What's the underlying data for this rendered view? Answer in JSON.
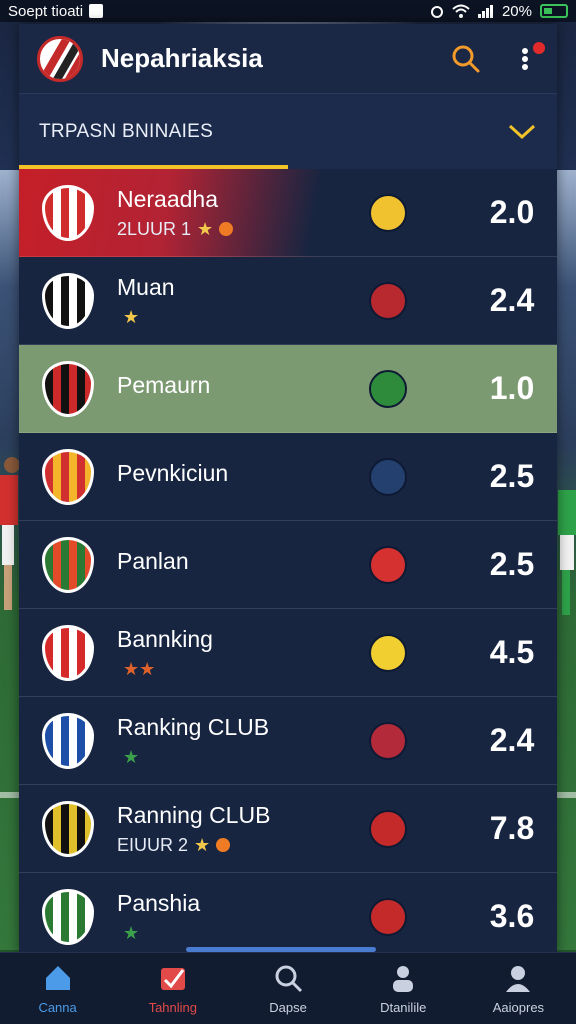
{
  "status_bar": {
    "left_text": "Soept tioati",
    "battery": "20%"
  },
  "header": {
    "title": "Nepahriaksia"
  },
  "filter": {
    "label": "TRPASN BNINAIES",
    "progress": 0.5
  },
  "rows": [
    {
      "name": "Neraadha",
      "sub": "2LUUR 1",
      "score": "2.0",
      "crest_colors": [
        "#d12c2c",
        "#ffffff"
      ],
      "opp_color": "#f1c230",
      "highlight": "first"
    },
    {
      "name": "Muan",
      "sub": "",
      "score": "2.4",
      "crest_colors": [
        "#111111",
        "#ffffff"
      ],
      "opp_color": "#b8282f"
    },
    {
      "name": "Pemaurn",
      "sub": "",
      "score": "1.0",
      "crest_colors": [
        "#111111",
        "#cc2a2a"
      ],
      "opp_color": "#2e8b3b",
      "highlight": "green"
    },
    {
      "name": "Pevnkiciun",
      "sub": "",
      "score": "2.5",
      "crest_colors": [
        "#d03030",
        "#f5b52a"
      ],
      "opp_color": "#24406f"
    },
    {
      "name": "Panlan",
      "sub": "",
      "score": "2.5",
      "crest_colors": [
        "#2a7a34",
        "#e24a2a"
      ],
      "opp_color": "#d63131"
    },
    {
      "name": "Bannking",
      "sub": "",
      "score": "4.5",
      "crest_colors": [
        "#d62a2a",
        "#ffffff"
      ],
      "opp_color": "#f2cf30"
    },
    {
      "name": "Ranking CLUB",
      "sub": "",
      "score": "2.4",
      "crest_colors": [
        "#1e4fa8",
        "#ffffff"
      ],
      "opp_color": "#b32a3a"
    },
    {
      "name": "Ranning CLUB",
      "sub": "EIUUR 2",
      "score": "7.8",
      "crest_colors": [
        "#111111",
        "#e0c02a"
      ],
      "opp_color": "#c42a2a"
    },
    {
      "name": "Panshia",
      "sub": "",
      "score": "3.6",
      "crest_colors": [
        "#2a7a34",
        "#ffffff"
      ],
      "opp_color": "#c42a2a"
    }
  ],
  "nav": [
    {
      "label": "Canna",
      "icon": "home-icon",
      "state": "active"
    },
    {
      "label": "Tahnling",
      "icon": "ranking-icon",
      "state": "active2"
    },
    {
      "label": "Dapse",
      "icon": "search-icon",
      "state": ""
    },
    {
      "label": "Dtanilile",
      "icon": "players-icon",
      "state": ""
    },
    {
      "label": "Aaiopres",
      "icon": "profile-icon",
      "state": ""
    }
  ]
}
